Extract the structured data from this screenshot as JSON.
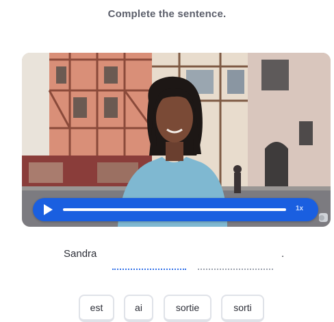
{
  "instruction": "Complete the sentence.",
  "video": {
    "play_icon": "play-icon",
    "speed_label": "1x",
    "progress": 0
  },
  "sentence": {
    "subject": "Sandra",
    "period": "."
  },
  "word_bank": [
    {
      "label": "est"
    },
    {
      "label": "ai"
    },
    {
      "label": "sortie"
    },
    {
      "label": "sorti"
    }
  ],
  "colors": {
    "player": "#1a5fe0",
    "active_blank": "#2e6fe8",
    "instruction_text": "#5b5e6a"
  }
}
